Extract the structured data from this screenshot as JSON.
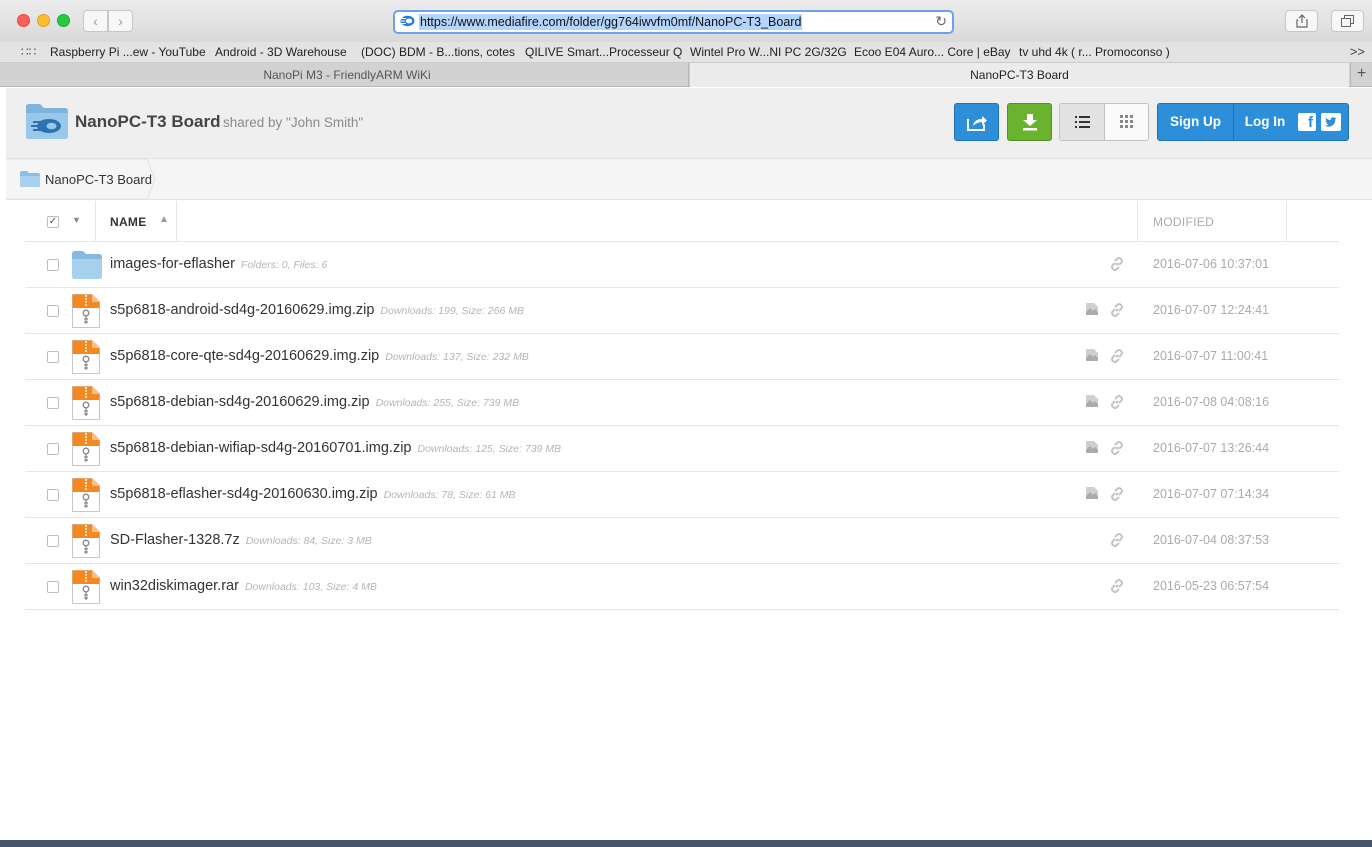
{
  "browser": {
    "url": "https://www.mediafire.com/folder/gg764iwvfm0mf/NanoPC-T3_Board",
    "bookmarks": [
      "Raspberry Pi ...ew - YouTube",
      "Android - 3D Warehouse",
      "(DOC) BDM - B...tions, cotes",
      "QILIVE Smart...Processeur Q",
      "Wintel Pro W...NI PC 2G/32G",
      "Ecoo E04 Auro... Core | eBay",
      "tv uhd 4k ( r... Promoconso )"
    ],
    "bookmarks_more": ">>",
    "tabs": [
      "NanoPi M3 - FriendlyARM WiKi",
      "NanoPC-T3 Board"
    ],
    "new_tab": "+"
  },
  "header": {
    "folder_title": "NanoPC-T3 Board",
    "shared_by": "shared by \"John Smith\"",
    "sign_up": "Sign Up",
    "log_in": "Log In",
    "facebook": "f",
    "accent_blue": "#2d8ed9",
    "download_green": "#6ab32f"
  },
  "breadcrumb": {
    "label": "NanoPC-T3 Board"
  },
  "list": {
    "col_name": "NAME",
    "col_modified": "MODIFIED",
    "rows": [
      {
        "name": "images-for-eflasher",
        "meta": "Folders: 0, Files: 6",
        "date": "2016-07-06 10:37:01",
        "type": "folder",
        "icons": [
          "link-icon"
        ]
      },
      {
        "name": "s5p6818-android-sd4g-20160629.img.zip",
        "meta": "Downloads: 199, Size: 266 MB",
        "date": "2016-07-07 12:24:41",
        "type": "zip",
        "icons": [
          "preview-icon",
          "link-icon"
        ]
      },
      {
        "name": "s5p6818-core-qte-sd4g-20160629.img.zip",
        "meta": "Downloads: 137, Size: 232 MB",
        "date": "2016-07-07 11:00:41",
        "type": "zip",
        "icons": [
          "preview-icon",
          "link-icon"
        ]
      },
      {
        "name": "s5p6818-debian-sd4g-20160629.img.zip",
        "meta": "Downloads: 255, Size: 739 MB",
        "date": "2016-07-08 04:08:16",
        "type": "zip",
        "icons": [
          "preview-icon",
          "link-icon"
        ]
      },
      {
        "name": "s5p6818-debian-wifiap-sd4g-20160701.img.zip",
        "meta": "Downloads: 125, Size: 739 MB",
        "date": "2016-07-07 13:26:44",
        "type": "zip",
        "icons": [
          "preview-icon",
          "link-icon"
        ]
      },
      {
        "name": "s5p6818-eflasher-sd4g-20160630.img.zip",
        "meta": "Downloads: 78, Size: 61 MB",
        "date": "2016-07-07 07:14:34",
        "type": "zip",
        "icons": [
          "preview-icon",
          "link-icon"
        ]
      },
      {
        "name": "SD-Flasher-1328.7z",
        "meta": "Downloads: 84, Size: 3 MB",
        "date": "2016-07-04 08:37:53",
        "type": "zip",
        "icons": [
          "link-icon"
        ]
      },
      {
        "name": "win32diskimager.rar",
        "meta": "Downloads: 103, Size: 4 MB",
        "date": "2016-05-23 06:57:54",
        "type": "zip",
        "icons": [
          "link-icon"
        ]
      }
    ]
  }
}
